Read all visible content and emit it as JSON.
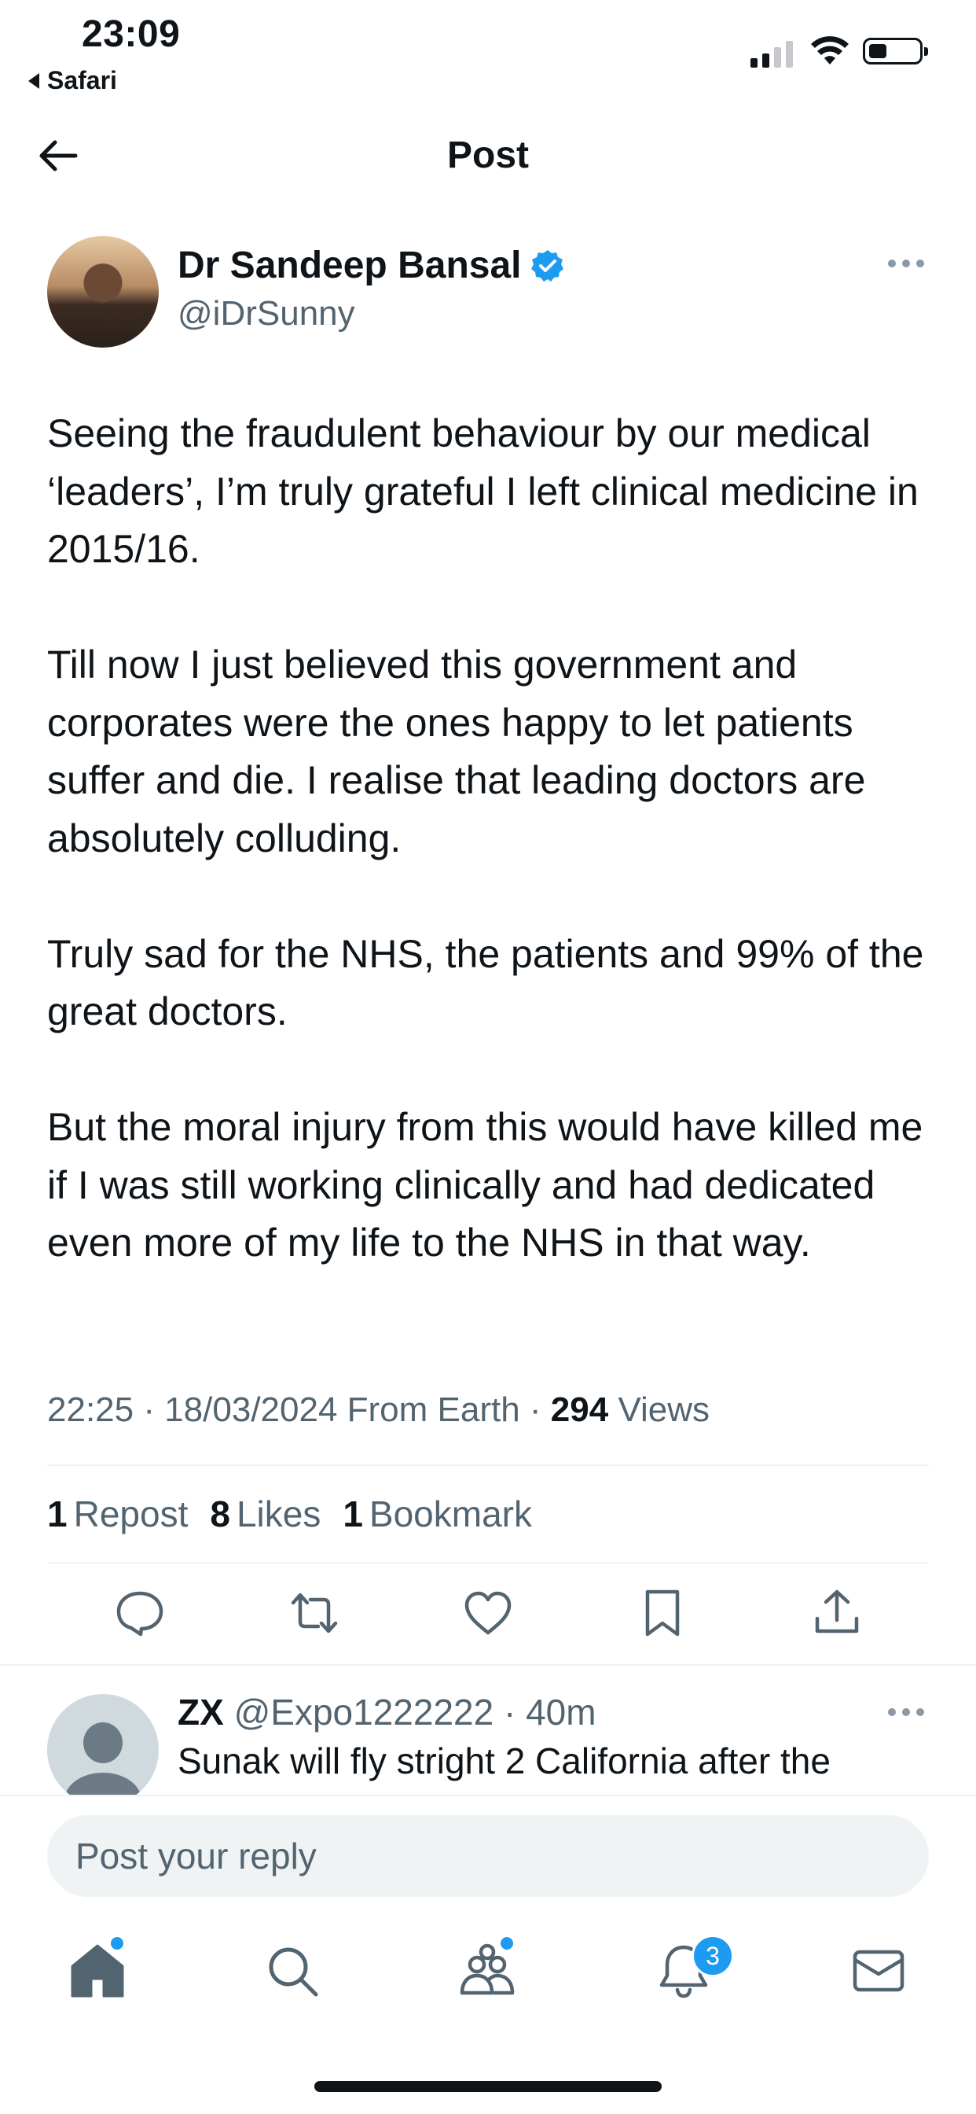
{
  "status_bar": {
    "time": "23:09",
    "back_app": "Safari"
  },
  "header": {
    "title": "Post"
  },
  "post": {
    "author_name": "Dr Sandeep Bansal",
    "handle": "@iDrSunny",
    "verified": true,
    "paragraphs": [
      "Seeing the fraudulent behaviour by our medical ‘leaders’, I’m truly grateful I left clinical medicine in 2015/16.",
      "Till now I just believed this government and corporates were the ones happy to let patients suffer and die. I realise that leading doctors are absolutely colluding.",
      "Truly sad for the NHS, the patients and 99% of the great doctors.",
      "But the moral injury from this would have killed me if I was still working clinically and had dedicated even more of my life to the NHS in that way."
    ],
    "meta_prefix": "22:25 · 18/03/2024 From Earth · ",
    "views_count": "294",
    "views_label": "Views",
    "reposts_count": "1",
    "reposts_label": "Repost",
    "likes_count": "8",
    "likes_label": "Likes",
    "bookmarks_count": "1",
    "bookmarks_label": "Bookmark"
  },
  "reply": {
    "author_name": "ZX",
    "handle_time": "@Expo1222222 · 40m",
    "text": "Sunak will fly stright 2 California after the"
  },
  "composer": {
    "placeholder": "Post your reply"
  },
  "tab_bar": {
    "items": [
      "home-icon",
      "search-icon",
      "communities-icon",
      "notifications-icon",
      "messages-icon"
    ],
    "notifications_badge": "3"
  },
  "colors": {
    "accent": "#1d9bf0",
    "text": "#0f1419",
    "secondary": "#536471",
    "divider": "#eff3f4"
  }
}
